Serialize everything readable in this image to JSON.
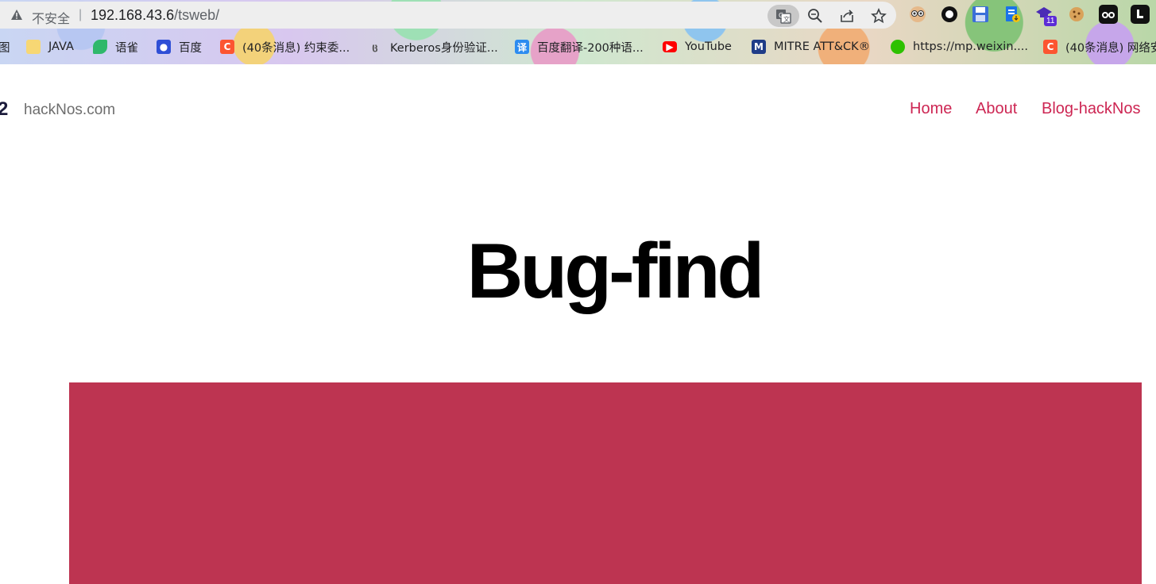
{
  "browser": {
    "security_label": "不安全",
    "separator": "|",
    "url_host": "192.168.43.6",
    "url_path": "/tsweb/",
    "toolbar_icons": [
      "translate-icon",
      "zoom-icon",
      "share-icon",
      "bookmark-star-icon"
    ],
    "extensions": [
      {
        "name": "owl-extension-icon"
      },
      {
        "name": "ring-extension-icon"
      },
      {
        "name": "save-extension-icon"
      },
      {
        "name": "doc-download-extension-icon"
      },
      {
        "name": "academic-extension-icon",
        "badge": "11"
      },
      {
        "name": "cookie-extension-icon"
      },
      {
        "name": "glasses-extension-icon"
      },
      {
        "name": "letter-l-extension-icon"
      }
    ]
  },
  "bookmarks": [
    {
      "label": "图",
      "icon": "folder-icon"
    },
    {
      "label": "JAVA",
      "icon": "folder-icon"
    },
    {
      "label": "语雀",
      "icon": "yuque-icon"
    },
    {
      "label": "百度",
      "icon": "baidu-icon"
    },
    {
      "label": "(40条消息) 约束委...",
      "icon": "csdn-icon"
    },
    {
      "label": "Kerberos身份验证...",
      "icon": "kerberos-icon"
    },
    {
      "label": "百度翻译-200种语...",
      "icon": "translate-icon"
    },
    {
      "label": "YouTube",
      "icon": "youtube-icon"
    },
    {
      "label": "MITRE ATT&CK®",
      "icon": "mitre-icon"
    },
    {
      "label": "https://mp.weixin....",
      "icon": "wechat-icon"
    },
    {
      "label": "(40条消息) 网络安",
      "icon": "csdn-icon"
    }
  ],
  "site": {
    "logo_glyph": "2",
    "title": "hackNos.com",
    "nav": [
      "Home",
      "About",
      "Blog-hackNos"
    ],
    "heading": "Bug-find"
  },
  "colors": {
    "accent": "#cd2653",
    "hero_block": "#bd3451"
  }
}
